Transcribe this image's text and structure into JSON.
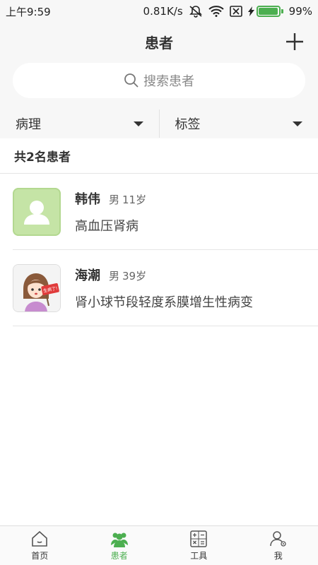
{
  "status_bar": {
    "time": "上午9:59",
    "speed": "0.81K/s",
    "battery": "99%",
    "battery_level": 0.99
  },
  "header": {
    "title": "患者"
  },
  "search": {
    "placeholder": "搜索患者"
  },
  "filters": [
    {
      "label": "病理"
    },
    {
      "label": "标签"
    }
  ],
  "patients_count": "共2名患者",
  "patients": [
    {
      "name": "韩伟",
      "gender": "男",
      "age": "11岁",
      "diagnosis": "高血压肾病",
      "avatar": "default-person-icon"
    },
    {
      "name": "海潮",
      "gender": "男",
      "age": "39岁",
      "diagnosis": "肾小球节段轻度系膜增生性病变",
      "avatar": "cartoon-girl-avatar",
      "avatar_sign_text": "生病了!"
    }
  ],
  "tabs": [
    {
      "label": "首页",
      "icon": "home-icon"
    },
    {
      "label": "患者",
      "icon": "patients-icon",
      "active": true
    },
    {
      "label": "工具",
      "icon": "calculator-icon"
    },
    {
      "label": "我",
      "icon": "profile-icon"
    }
  ],
  "colors": {
    "accent": "#4caf50",
    "avatar_bg": "#c5e4a6"
  }
}
